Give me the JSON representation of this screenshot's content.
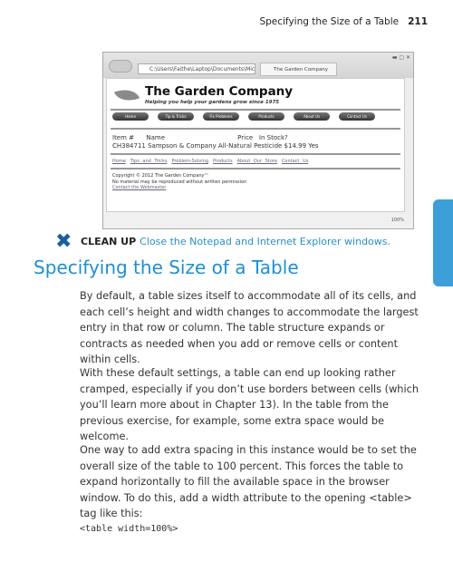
{
  "running_head": {
    "title": "Specifying the Size of a Table",
    "page": "211"
  },
  "screenshot": {
    "address": "C:\\Users\\Faithe\\Laptop\\Documents\\Micr",
    "tab_title": "The Garden Company",
    "site_title": "The Garden Company",
    "tagline": "Helping you help your gardens grow since 1975",
    "nav_buttons": [
      "Home",
      "Tip & Tricks",
      "Fix Problems",
      "Products",
      "About Us",
      "Contact Us"
    ],
    "table": {
      "headers": [
        "Item #",
        "Name",
        "Price",
        "In Stock?"
      ],
      "row": [
        "CH384711",
        "Sampson & Company All-Natural Pesticide",
        "$14.99",
        "Yes"
      ]
    },
    "footer_links": [
      "Home",
      "Tips and Tricks",
      "Problem-Solving",
      "Products",
      "About Our Store",
      "Contact Us"
    ],
    "copyright": "Copyright © 2012 The Garden Company™",
    "notice": "No material may be reproduced without written permission",
    "contact": "Contact the Webmaster",
    "zoom": "100%"
  },
  "cleanup": {
    "label": "CLEAN UP",
    "text": "Close the Notepad and Internet Explorer windows."
  },
  "heading": "Specifying the Size of a Table",
  "paragraphs": [
    "By default, a table sizes itself to accommodate all of its cells, and each cell’s height and width changes to accommodate the largest entry in that row or column. The table structure expands or contracts as needed when you add or remove cells or content within cells.",
    "With these default settings, a table can end up looking rather cramped, especially if you don’t use borders between cells (which you’ll learn more about in Chapter 13). In the table from the previous exercise, for example, some extra space would be welcome.",
    "One way to add extra spacing in this instance would be to set the overall size of the table to 100 percent. This forces the table to expand horizontally to fill the available space in the browser window. To do this, add a width attribute to the opening <table> tag like this:"
  ],
  "code": "<table width=100%>",
  "colors": {
    "accent": "#1e8fd0",
    "side_tab": "#3d9fd8"
  }
}
